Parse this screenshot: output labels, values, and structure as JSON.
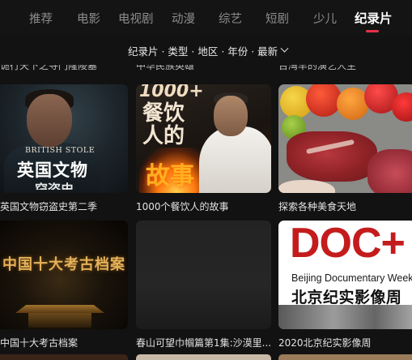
{
  "nav": {
    "tabs": [
      {
        "label": "推荐",
        "active": false
      },
      {
        "label": "电影",
        "active": false
      },
      {
        "label": "电视剧",
        "active": false
      },
      {
        "label": "动漫",
        "active": false
      },
      {
        "label": "综艺",
        "active": false
      },
      {
        "label": "短剧",
        "active": false
      },
      {
        "label": "少儿",
        "active": false
      },
      {
        "label": "纪录片",
        "active": true
      }
    ],
    "accent_color": "#e8304a"
  },
  "filter": {
    "label": "纪录片 · 类型 · 地区 · 年份 · 最新"
  },
  "partial_row": [
    {
      "caption": "诡行天下之寻门隆陵墓"
    },
    {
      "caption": "中华民族英雄"
    },
    {
      "caption": "台湾早的演艺人生"
    }
  ],
  "grid": [
    {
      "caption": "英国文物窃盗史第二季",
      "poster_text": [
        "BRITISH STOLE",
        "英国文物",
        "窃盗史"
      ]
    },
    {
      "caption": "1000个餐饮人的故事",
      "poster_text": [
        "1000+",
        "餐饮人的",
        "故事"
      ]
    },
    {
      "caption": "探索各种美食天地",
      "poster_text": []
    },
    {
      "caption": "中国十大考古档案",
      "poster_text": [
        "中国十大考古档案"
      ]
    },
    {
      "caption": "春山可望巾帼篇第1集:沙漠里...",
      "poster_text": []
    },
    {
      "caption": "2020北京纪实影像周",
      "poster_text": [
        "DOC+",
        "Beijing Documentary Week",
        "北京纪实影像周"
      ]
    }
  ]
}
